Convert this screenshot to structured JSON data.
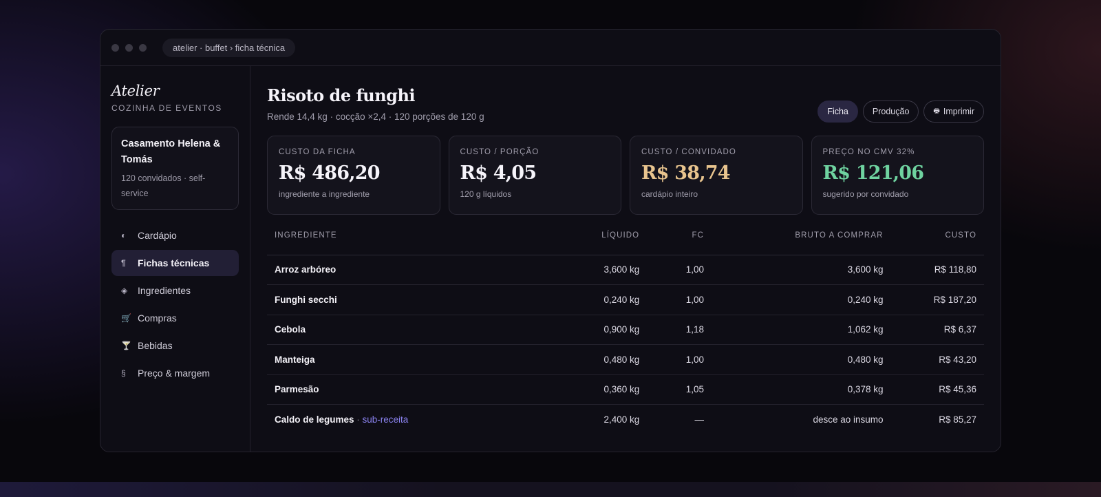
{
  "window": {
    "url": "atelier · buffet › ficha técnica"
  },
  "sidebar": {
    "brand": "Atelier",
    "brand_sub": "COZINHA DE EVENTOS",
    "event": {
      "title": "Casamento Helena & Tomás",
      "meta": "120 convidados · self-service"
    },
    "items": [
      {
        "label": "Cardápio",
        "icon": "◐"
      },
      {
        "label": "Fichas técnicas",
        "icon": "¶"
      },
      {
        "label": "Ingredientes",
        "icon": "◈"
      },
      {
        "label": "Compras",
        "icon": "🛒"
      },
      {
        "label": "Bebidas",
        "icon": "🍸"
      },
      {
        "label": "Preço & margem",
        "icon": "§"
      }
    ]
  },
  "main": {
    "title": "Risoto de funghi",
    "subtitle": "Rende 14,4 kg · cocção ×2,4 · 120 porções de 120 g",
    "tabs": [
      {
        "label": "Ficha"
      },
      {
        "label": "Produção"
      },
      {
        "label": "Imprimir",
        "icon": "🖶"
      }
    ],
    "kpis": [
      {
        "label": "CUSTO DA FICHA",
        "value": "R$ 486,20",
        "note": "ingrediente a ingrediente",
        "color": "#f6f4fa"
      },
      {
        "label": "CUSTO / PORÇÃO",
        "value": "R$ 4,05",
        "note": "120 g líquidos",
        "color": "#f6f4fa"
      },
      {
        "label": "CUSTO / CONVIDADO",
        "value": "R$ 38,74",
        "note": "cardápio inteiro",
        "color": "#e8c48e"
      },
      {
        "label": "PREÇO NO CMV 32%",
        "value": "R$ 121,06",
        "note": "sugerido por convidado",
        "color": "#6fd3a0"
      }
    ],
    "table": {
      "headers": [
        "INGREDIENTE",
        "LÍQUIDO",
        "FC",
        "BRUTO A COMPRAR",
        "CUSTO"
      ],
      "rows": [
        {
          "name": "Arroz arbóreo",
          "tag": "",
          "liquido": "3,600 kg",
          "fc": "1,00",
          "bruto": "3,600 kg",
          "custo": "R$ 118,80"
        },
        {
          "name": "Funghi secchi",
          "tag": "",
          "liquido": "0,240 kg",
          "fc": "1,00",
          "bruto": "0,240 kg",
          "custo": "R$ 187,20"
        },
        {
          "name": "Cebola",
          "tag": "",
          "liquido": "0,900 kg",
          "fc": "1,18",
          "bruto": "1,062 kg",
          "custo": "R$ 6,37"
        },
        {
          "name": "Manteiga",
          "tag": "",
          "liquido": "0,480 kg",
          "fc": "1,00",
          "bruto": "0,480 kg",
          "custo": "R$ 43,20"
        },
        {
          "name": "Parmesão",
          "tag": "",
          "liquido": "0,360 kg",
          "fc": "1,05",
          "bruto": "0,378 kg",
          "custo": "R$ 45,36"
        },
        {
          "name": "Caldo de legumes",
          "tag": "sub-receita",
          "liquido": "2,400 kg",
          "fc": "—",
          "bruto": "desce ao insumo",
          "custo": "R$ 85,27"
        }
      ]
    }
  }
}
